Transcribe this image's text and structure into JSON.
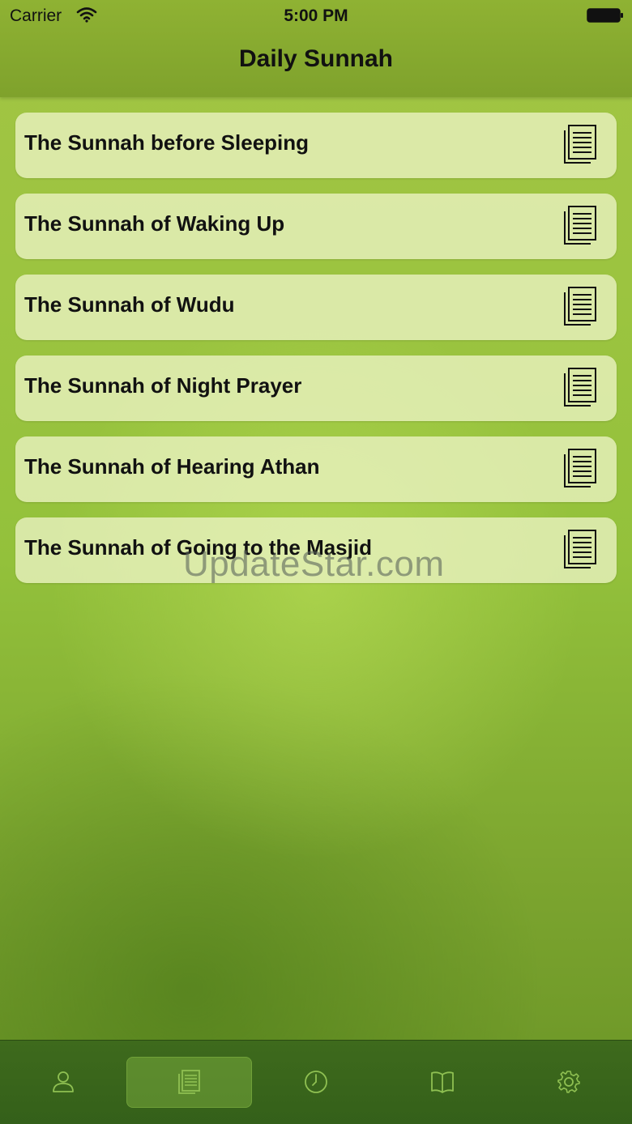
{
  "status_bar": {
    "carrier": "Carrier",
    "time": "5:00 PM",
    "icons": [
      "wifi-icon",
      "battery-icon"
    ]
  },
  "nav": {
    "title": "Daily Sunnah"
  },
  "items": [
    {
      "label": "The Sunnah before Sleeping",
      "icon": "document-icon"
    },
    {
      "label": "The Sunnah of Waking Up",
      "icon": "document-icon"
    },
    {
      "label": "The Sunnah of Wudu",
      "icon": "document-icon"
    },
    {
      "label": "The Sunnah of Night Prayer",
      "icon": "document-icon"
    },
    {
      "label": "The Sunnah of Hearing Athan",
      "icon": "document-icon"
    },
    {
      "label": "The Sunnah of Going to the Masjid",
      "icon": "document-icon"
    }
  ],
  "watermark": "UpdateStar.com",
  "tab_bar": {
    "tabs": [
      {
        "icon": "person-icon",
        "selected": false
      },
      {
        "icon": "document-icon",
        "selected": true
      },
      {
        "icon": "clock-icon",
        "selected": false
      },
      {
        "icon": "book-icon",
        "selected": false
      },
      {
        "icon": "gear-icon",
        "selected": false
      }
    ]
  },
  "colors": {
    "background": "#93c13b",
    "nav_bar": "#86aa2f",
    "tab_bar": "#3a661b",
    "tab_icon": "#8fc052",
    "row": "#ecf4c4",
    "text": "#111111"
  }
}
